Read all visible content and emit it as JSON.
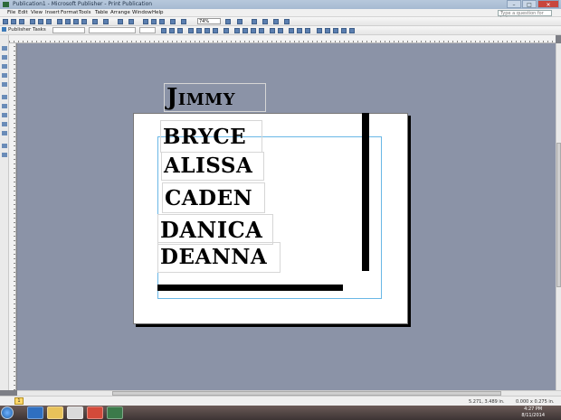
{
  "window": {
    "title": "Publication1 - Microsoft Publisher - Print Publication"
  },
  "menu": {
    "items": [
      "File",
      "Edit",
      "View",
      "Insert",
      "Format",
      "Tools",
      "Table",
      "Arrange",
      "Window",
      "Help"
    ],
    "ask_placeholder": "Type a question for help"
  },
  "toolbar": {
    "zoom": "74%",
    "task_pane_label": "Publisher Tasks"
  },
  "document": {
    "names": [
      "Jimmy",
      "BRYCE",
      "ALISSA",
      "CADEN",
      "DANICA",
      "DEANNA"
    ]
  },
  "status": {
    "page": "1",
    "position": "5.271, 3.489 in.",
    "size": "0.000 x 0.275 in."
  },
  "taskbar": {
    "time": "4:27 PM",
    "date": "8/11/2014"
  }
}
